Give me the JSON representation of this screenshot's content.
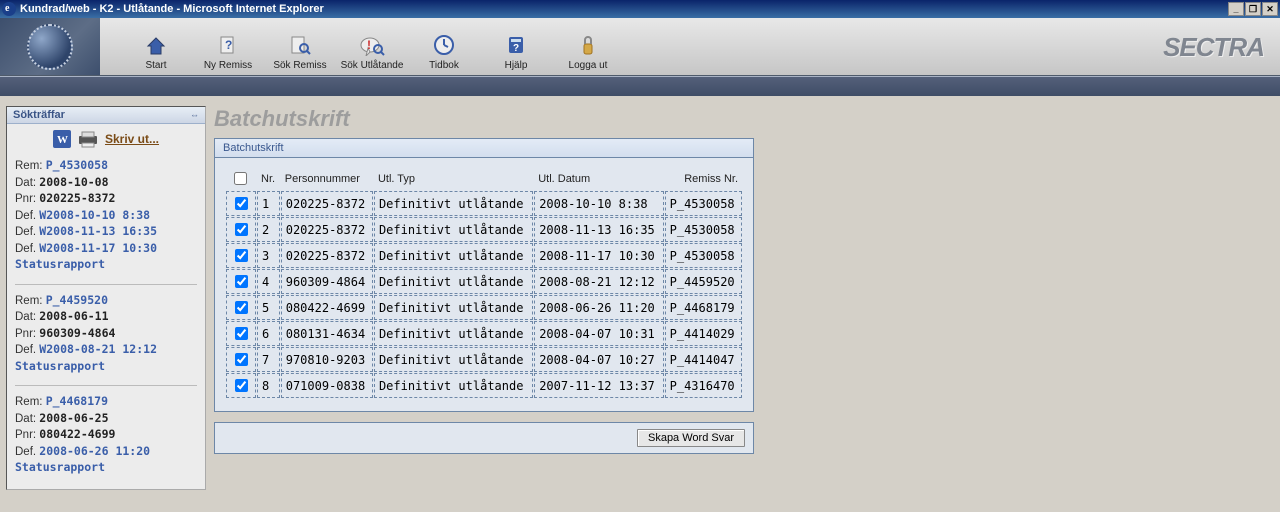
{
  "window": {
    "title": "Kundrad/web - K2 - Utlåtande - Microsoft Internet Explorer"
  },
  "brand": "SECTRA",
  "toolbar": [
    {
      "label": "Start",
      "name": "start-button"
    },
    {
      "label": "Ny Remiss",
      "name": "new-referral-button"
    },
    {
      "label": "Sök Remiss",
      "name": "search-referral-button"
    },
    {
      "label": "Sök Utlåtande",
      "name": "search-report-button"
    },
    {
      "label": "Tidbok",
      "name": "schedule-button"
    },
    {
      "label": "Hjälp",
      "name": "help-button"
    },
    {
      "label": "Logga ut",
      "name": "logout-button"
    }
  ],
  "sidebar": {
    "title": "Sökträffar",
    "print_label": "Skriv ut...",
    "labels": {
      "rem": "Rem:",
      "dat": "Dat:",
      "pnr": "Pnr:",
      "def": "Def.",
      "status": "Statusrapport"
    },
    "items": [
      {
        "rem": "P_4530058",
        "dat": "2008-10-08",
        "pnr": "020225-8372",
        "defs": [
          "W2008-10-10 8:38",
          "W2008-11-13 16:35",
          "W2008-11-17 10:30"
        ]
      },
      {
        "rem": "P_4459520",
        "dat": "2008-06-11",
        "pnr": "960309-4864",
        "defs": [
          "W2008-08-21 12:12"
        ]
      },
      {
        "rem": "P_4468179",
        "dat": "2008-06-25",
        "pnr": "080422-4699",
        "defs": [
          "2008-06-26 11:20"
        ]
      }
    ]
  },
  "main": {
    "title": "Batchutskrift",
    "panel_title": "Batchutskrift",
    "columns": {
      "nr": "Nr.",
      "pnr": "Personnummer",
      "typ": "Utl. Typ",
      "datum": "Utl. Datum",
      "remiss": "Remiss Nr."
    },
    "rows": [
      {
        "nr": "1",
        "pnr": "020225-8372",
        "typ": "Definitivt utlåtande",
        "datum": "2008-10-10 8:38",
        "remiss": "P_4530058"
      },
      {
        "nr": "2",
        "pnr": "020225-8372",
        "typ": "Definitivt utlåtande",
        "datum": "2008-11-13 16:35",
        "remiss": "P_4530058"
      },
      {
        "nr": "3",
        "pnr": "020225-8372",
        "typ": "Definitivt utlåtande",
        "datum": "2008-11-17 10:30",
        "remiss": "P_4530058"
      },
      {
        "nr": "4",
        "pnr": "960309-4864",
        "typ": "Definitivt utlåtande",
        "datum": "2008-08-21 12:12",
        "remiss": "P_4459520"
      },
      {
        "nr": "5",
        "pnr": "080422-4699",
        "typ": "Definitivt utlåtande",
        "datum": "2008-06-26 11:20",
        "remiss": "P_4468179"
      },
      {
        "nr": "6",
        "pnr": "080131-4634",
        "typ": "Definitivt utlåtande",
        "datum": "2008-04-07 10:31",
        "remiss": "P_4414029"
      },
      {
        "nr": "7",
        "pnr": "970810-9203",
        "typ": "Definitivt utlåtande",
        "datum": "2008-04-07 10:27",
        "remiss": "P_4414047"
      },
      {
        "nr": "8",
        "pnr": "071009-0838",
        "typ": "Definitivt utlåtande",
        "datum": "2007-11-12 13:37",
        "remiss": "P_4316470"
      }
    ],
    "button": "Skapa Word Svar"
  }
}
